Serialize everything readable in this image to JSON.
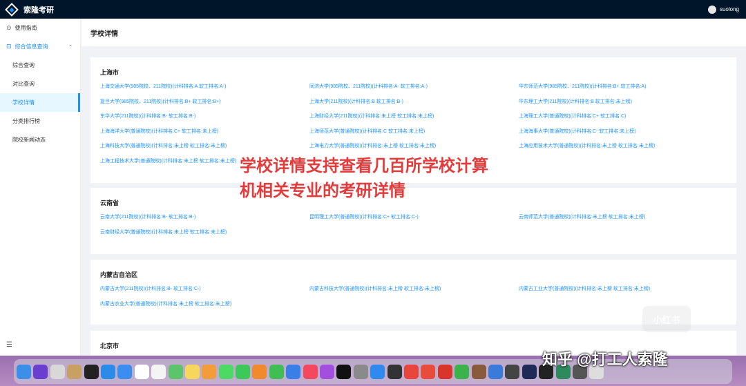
{
  "app": {
    "title": "索隆考研",
    "user": "suolong"
  },
  "sidebar": {
    "items": [
      {
        "icon": "⊙",
        "label": "使用指南"
      },
      {
        "icon": "⊡",
        "label": "综合信息查询",
        "chevron": "⌃"
      },
      {
        "label": "综合查询"
      },
      {
        "label": "对比查询"
      },
      {
        "label": "学校详情"
      },
      {
        "label": "分类排行榜"
      },
      {
        "label": "院校新闻动态"
      }
    ],
    "collapse_icon": "☰"
  },
  "page": {
    "title": "学校详情"
  },
  "regions": [
    {
      "name": "上海市",
      "schools": [
        "上海交通大学(985院校、211院校)(计科排名:A 软工排名:A-)",
        "同济大学(985院校、211院校)(计科排名:A- 软工排名:A-)",
        "华东师范大学(985院校、211院校)(计科排名:B+ 软工排名:A)",
        "复旦大学(985院校、211院校)(计科排名:B+ 软工排名:B+)",
        "上海大学(211院校)(计科排名:B 软工排名:B-)",
        "华东理工大学(211院校)(计科排名:B 软工排名:未上榜)",
        "东华大学(211院校)(计科排名:B- 软工排名:B-)",
        "上海财经大学(211院校)(计科排名:未上榜 软工排名:未上榜)",
        "上海理工大学(普通院校)(计科排名:C+ 软工排名:C)",
        "上海海洋大学(普通院校)(计科排名:C+ 软工排名:未上榜)",
        "上海师范大学(普通院校)(计科排名:C 软工排名:未上榜)",
        "上海海事大学(普通院校)(计科排名:C- 软工排名:未上榜)",
        "上海科技大学(普通院校)(计科排名:未上榜 软工排名:未上榜)",
        "上海电力大学(普通院校)(计科排名:未上榜 软工排名:未上榜)",
        "上海应用技术大学(普通院校)(计科排名:未上榜 软工排名:未上榜)",
        "上海工程技术大学(普通院校)(计科排名:未上榜 软工排名:未上榜)"
      ]
    },
    {
      "name": "云南省",
      "schools": [
        "云南大学(211院校)(计科排名:B- 软工排名:B-)",
        "昆明理工大学(普通院校)(计科排名:C+ 软工排名:C-)",
        "云南师范大学(普通院校)(计科排名:未上榜 软工排名:未上榜)",
        "云南财经大学(普通院校)(计科排名:未上榜 软工排名:未上榜)"
      ]
    },
    {
      "name": "内蒙古自治区",
      "schools": [
        "内蒙古大学(211院校)(计科排名:B- 软工排名:C-)",
        "内蒙古科技大学(普通院校)(计科排名:未上榜 软工排名:未上榜)",
        "内蒙古工业大学(普通院校)(计科排名:未上榜 软工排名:未上榜)",
        "内蒙古农业大学(普通院校)(计科排名:未上榜 软工排名:未上榜)"
      ]
    },
    {
      "name": "北京市",
      "schools": []
    }
  ],
  "overlay": {
    "caption": "学校详情支持查看几百所学校计算机相关专业的考研详情",
    "color": "#e23b3b",
    "badge": "小红书",
    "dock_watermark": "知乎 @打工人索隆"
  },
  "dock": {
    "icons": [
      {
        "name": "finder-icon",
        "color": "#3b8fe8"
      },
      {
        "name": "siri-icon",
        "color": "#6a3fd0"
      },
      {
        "name": "launchpad-icon",
        "color": "#d8d8d8"
      },
      {
        "name": "notes-app-icon",
        "color": "#c9a063"
      },
      {
        "name": "terminal-icon",
        "color": "#222222"
      },
      {
        "name": "safari-icon",
        "color": "#2a8ce8"
      },
      {
        "name": "mail-icon",
        "color": "#3a8ef0"
      },
      {
        "name": "calendar-icon",
        "color": "#ffffff"
      },
      {
        "name": "reminders-icon",
        "color": "#f4f4f4"
      },
      {
        "name": "maps-icon",
        "color": "#5cc46a"
      },
      {
        "name": "notes-icon",
        "color": "#f6d75c"
      },
      {
        "name": "photos-icon",
        "color": "#f29c3a"
      },
      {
        "name": "messages-icon",
        "color": "#4cd964"
      },
      {
        "name": "facetime-icon",
        "color": "#3cc95a"
      },
      {
        "name": "pages-icon",
        "color": "#f08a2c"
      },
      {
        "name": "numbers-icon",
        "color": "#3fbf53"
      },
      {
        "name": "keynote-icon",
        "color": "#3a7ee8"
      },
      {
        "name": "music-icon",
        "color": "#f3485e"
      },
      {
        "name": "podcasts-icon",
        "color": "#a44ee0"
      },
      {
        "name": "tv-icon",
        "color": "#111111"
      },
      {
        "name": "system-preferences-icon",
        "color": "#8a8a8a"
      },
      {
        "name": "app-store-icon",
        "color": "#2f8af0"
      },
      {
        "name": "utility-icon",
        "color": "#333333"
      },
      {
        "name": "chrome-icon",
        "color": "#e8453c"
      },
      {
        "name": "xmind-icon",
        "color": "#e74c3c"
      },
      {
        "name": "wps-icon",
        "color": "#d9362b"
      },
      {
        "name": "wechat-icon",
        "color": "#3cb34a"
      },
      {
        "name": "app-icon",
        "color": "#8a5a3c"
      },
      {
        "name": "app-icon-2",
        "color": "#3a7ad8"
      },
      {
        "name": "app-icon-3",
        "color": "#444444"
      },
      {
        "name": "webstorm-icon",
        "color": "#1f2b56"
      },
      {
        "name": "intellij-icon",
        "color": "#222222"
      },
      {
        "name": "datagrip-icon",
        "color": "#2d8a5c"
      },
      {
        "name": "app-icon-4",
        "color": "#555555"
      },
      {
        "name": "trash-icon",
        "color": "#dddddd"
      }
    ]
  }
}
